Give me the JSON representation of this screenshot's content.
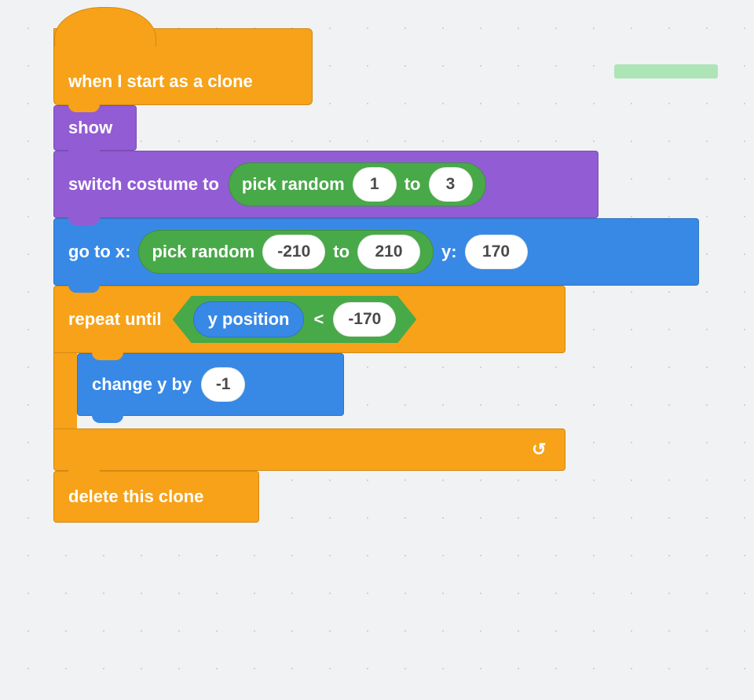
{
  "colors": {
    "control": "#f7a218",
    "looks": "#925cd4",
    "motion": "#3889e6",
    "operators": "#48a948",
    "input_bg": "#ffffff",
    "canvas_bg": "#f1f2f3"
  },
  "script": {
    "hat": {
      "label": "when I start as a clone"
    },
    "show": {
      "label": "show"
    },
    "switch_costume": {
      "label": "switch costume to",
      "picker": {
        "label": "pick random",
        "to_label": "to",
        "from": "1",
        "to": "3"
      }
    },
    "goto": {
      "label_x": "go to x:",
      "label_y": "y:",
      "y_value": "170",
      "picker": {
        "label": "pick random",
        "to_label": "to",
        "from": "-210",
        "to": "210"
      }
    },
    "repeat": {
      "label": "repeat until",
      "condition": {
        "reporter": "y position",
        "op": "<",
        "value": "-170"
      }
    },
    "change_y": {
      "label": "change y by",
      "value": "-1"
    },
    "delete": {
      "label": "delete this clone"
    }
  }
}
